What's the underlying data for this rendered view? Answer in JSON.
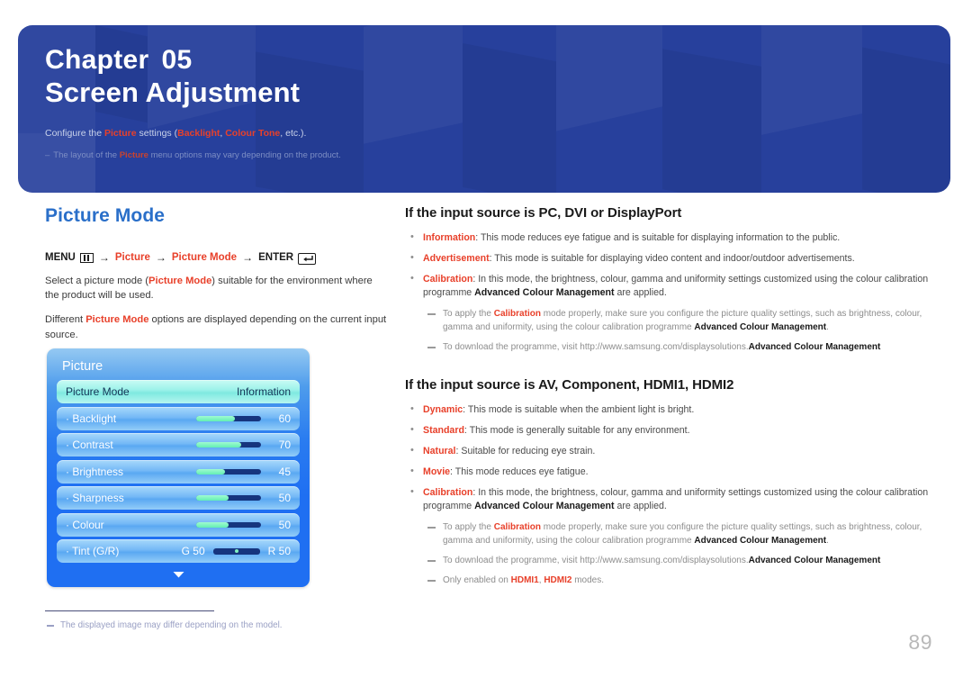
{
  "banner": {
    "chapter_label": "Chapter",
    "chapter_number": "05",
    "title": "Screen Adjustment",
    "desc_1": "Configure the ",
    "desc_picture": "Picture",
    "desc_2": " settings (",
    "desc_backlight": "Backlight",
    "desc_3": ", ",
    "desc_colourtone": "Colour Tone",
    "desc_4": ", etc.).",
    "note_dash": "–",
    "note_1": "The layout of the ",
    "note_picture": "Picture",
    "note_2": " menu options may vary depending on the product.",
    "bg_color": "#27409c"
  },
  "left": {
    "section_title": "Picture Mode",
    "menu_path": {
      "menu_label": "MENU",
      "menu_icon": "menu-bars-icon",
      "arrow": "→",
      "item_picture": "Picture",
      "item_picture_mode": "Picture Mode",
      "enter_label": "ENTER",
      "enter_icon": "enter-return-icon"
    },
    "para_1_a": "Select a picture mode (",
    "para_1_b": "Picture Mode",
    "para_1_c": ") suitable for the environment where the product will be used.",
    "para_2_a": "Different ",
    "para_2_b": "Picture Mode",
    "para_2_c": " options are displayed depending on the current input source."
  },
  "osd": {
    "title": "Picture",
    "rows": [
      {
        "label": "Picture Mode",
        "value": "Information",
        "type": "select",
        "selected": true
      },
      {
        "label": "· Backlight",
        "value": "60",
        "type": "slider",
        "percent": 60,
        "selected": false
      },
      {
        "label": "· Contrast",
        "value": "70",
        "type": "slider",
        "percent": 70,
        "selected": false
      },
      {
        "label": "· Brightness",
        "value": "45",
        "type": "slider",
        "percent": 45,
        "selected": false
      },
      {
        "label": "· Sharpness",
        "value": "50",
        "type": "slider",
        "percent": 50,
        "selected": false
      },
      {
        "label": "· Colour",
        "value": "50",
        "type": "slider",
        "percent": 50,
        "selected": false
      },
      {
        "label": "· Tint (G/R)",
        "value": "",
        "type": "tint",
        "g_label": "G 50",
        "r_label": "R 50",
        "selected": false
      }
    ],
    "scroll_caret": "caret-down-icon"
  },
  "right": {
    "heading_1": "If the input source is PC, DVI or DisplayPort",
    "bullets_1": [
      {
        "term": "Information",
        "rest": ": This mode reduces eye fatigue and is suitable for displaying information to the public."
      },
      {
        "term": "Advertisement",
        "rest": ": This mode is suitable for displaying video content and indoor/outdoor advertisements."
      },
      {
        "term": "Calibration",
        "rest": ": In this mode, the brightness, colour, gamma and uniformity settings customized using the colour calibration programme ",
        "bold": "Advanced Colour Management",
        "tail": " are applied."
      }
    ],
    "notes_1": [
      {
        "a": "To apply the ",
        "red": "Calibration",
        "b": " mode properly, make sure you configure the picture quality settings, such as brightness, colour, gamma and uniformity, using the colour calibration programme ",
        "bold": "Advanced Colour Management",
        "tail": "."
      },
      {
        "a": "To download the ",
        "bold": "Advanced Colour Management",
        "b": " programme, visit http://www.samsung.com/displaysolutions."
      }
    ],
    "heading_2": "If the input source is AV, Component, HDMI1, HDMI2",
    "bullets_2": [
      {
        "term": "Dynamic",
        "rest": ": This mode is suitable when the ambient light is bright."
      },
      {
        "term": "Standard",
        "rest": ": This mode is generally suitable for any environment."
      },
      {
        "term": "Natural",
        "rest": ": Suitable for reducing eye strain."
      },
      {
        "term": "Movie",
        "rest": ": This mode reduces eye fatigue."
      },
      {
        "term": "Calibration",
        "rest": ": In this mode, the brightness, colour, gamma and uniformity settings customized using the colour calibration programme ",
        "bold": "Advanced Colour Management",
        "tail": " are applied."
      }
    ],
    "notes_2": [
      {
        "a": "To apply the ",
        "red": "Calibration",
        "b": " mode properly, make sure you configure the picture quality settings, such as brightness, colour, gamma and uniformity, using the colour calibration programme ",
        "bold": "Advanced Colour Management",
        "tail": "."
      },
      {
        "a": "To download the ",
        "bold": "Advanced Colour Management",
        "b": " programme, visit http://www.samsung.com/displaysolutions."
      },
      {
        "a": "Only enabled on ",
        "red2": "HDMI1",
        "mid": ", ",
        "red3": "HDMI2",
        "b": " modes."
      }
    ]
  },
  "footer": {
    "footnote": "The displayed image may differ depending on the model.",
    "page_number": "89"
  },
  "colors": {
    "banner_blue": "#27409c",
    "accent_red": "#e8402a",
    "heading_blue": "#2a6fc9",
    "osd_blue": "#1f6ff2",
    "slider_fill": "#7ff0c0"
  }
}
